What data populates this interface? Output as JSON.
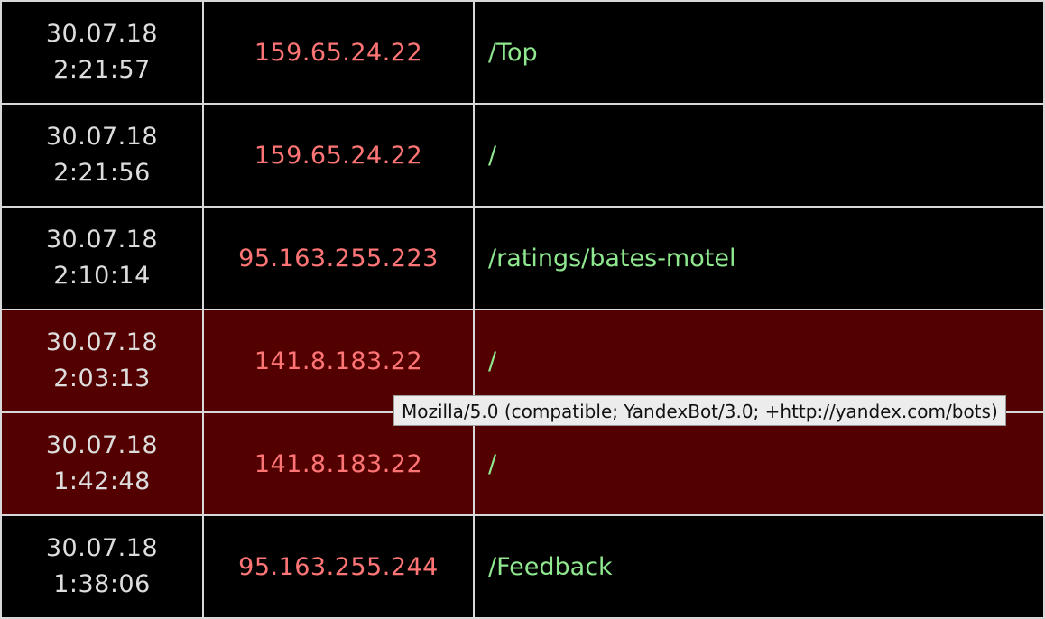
{
  "log": {
    "rows": [
      {
        "date": "30.07.18",
        "time": "2:21:57",
        "ip": "159.65.24.22",
        "path": "/Top",
        "highlighted": false
      },
      {
        "date": "30.07.18",
        "time": "2:21:56",
        "ip": "159.65.24.22",
        "path": "/",
        "highlighted": false
      },
      {
        "date": "30.07.18",
        "time": "2:10:14",
        "ip": "95.163.255.223",
        "path": "/ratings/bates-motel",
        "highlighted": false
      },
      {
        "date": "30.07.18",
        "time": "2:03:13",
        "ip": "141.8.183.22",
        "path": "/",
        "highlighted": true
      },
      {
        "date": "30.07.18",
        "time": "1:42:48",
        "ip": "141.8.183.22",
        "path": "/",
        "highlighted": true
      },
      {
        "date": "30.07.18",
        "time": "1:38:06",
        "ip": "95.163.255.244",
        "path": "/Feedback",
        "highlighted": false
      }
    ]
  },
  "tooltip": {
    "text": "Mozilla/5.0 (compatible; YandexBot/3.0; +http://yandex.com/bots)"
  },
  "colors": {
    "background": "#000000",
    "highlight_row": "#520000",
    "timestamp_text": "#dddddd",
    "ip_text": "#ff7575",
    "path_text": "#8fe88f",
    "grid_line": "#d8d8d8",
    "tooltip_bg": "#ececec"
  }
}
